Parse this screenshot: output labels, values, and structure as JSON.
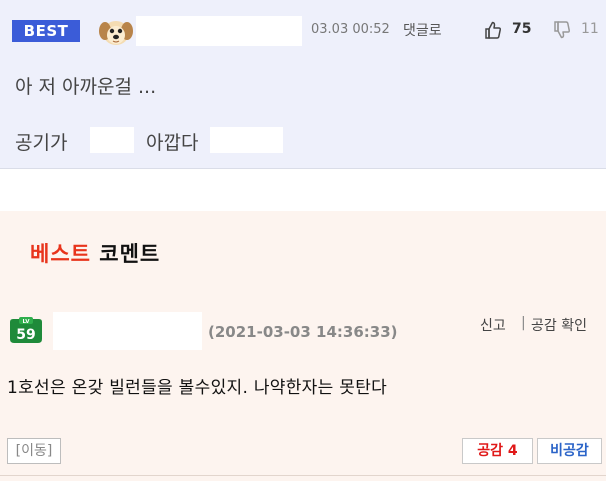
{
  "top_comment": {
    "badge": "BEST",
    "time": "03.03 00:52",
    "reply_label": "댓글로",
    "up_count": "75",
    "down_count": "11",
    "line1": "아 저 아까운걸 ...",
    "line2_part1": "공기가",
    "line2_part2": "아깝다"
  },
  "best_panel": {
    "title_red": "베스트",
    "title_black": "코멘트",
    "level": "59",
    "level_label": "LV",
    "date": "(2021-03-03 14:36:33)",
    "report_label": "신고",
    "separator": "|",
    "check_label": "공감 확인",
    "comment": "1호선은 온갖 빌런들을 볼수있지. 나약한자는 못탄다",
    "move_label": "[이동]",
    "like_label": "공감 4",
    "dislike_label": "비공감"
  },
  "colors": {
    "badge_bg": "#3b5cd8",
    "top_bg": "#eef0fb",
    "panel_bg": "#fdf4ef",
    "title_red": "#e8341c",
    "like_red": "#e01818",
    "dislike_blue": "#2b64c8",
    "level_green": "#1f8a3a"
  }
}
